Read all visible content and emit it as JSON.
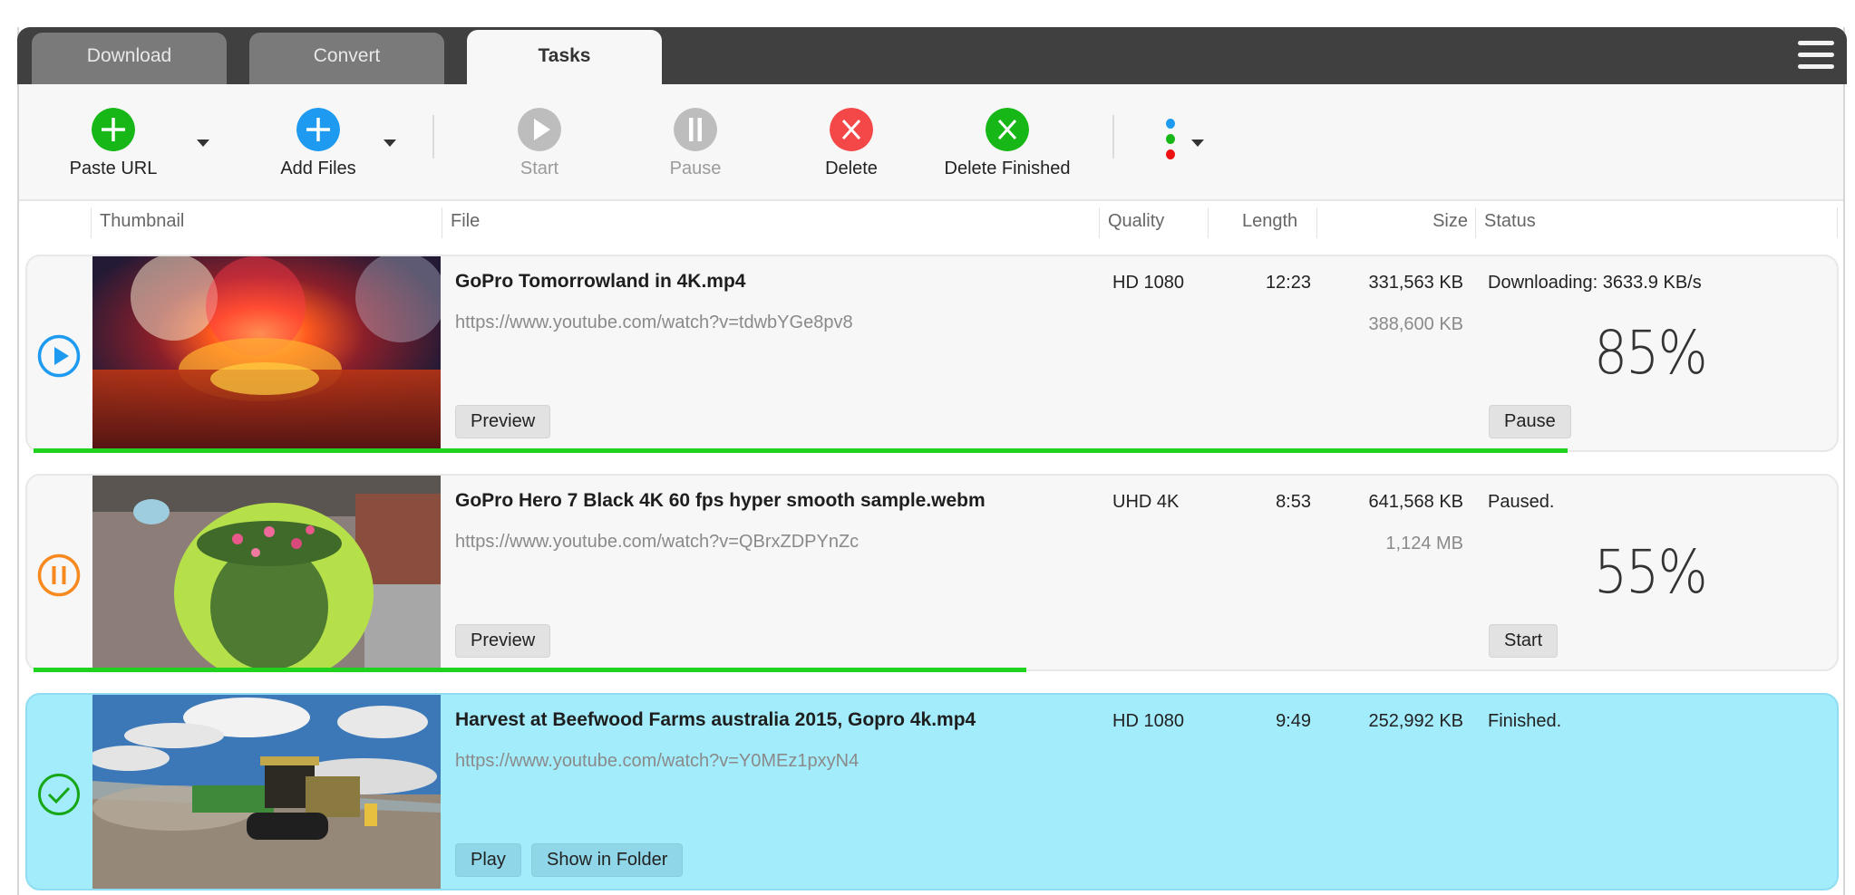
{
  "tabs": [
    {
      "label": "Download",
      "active": false
    },
    {
      "label": "Convert",
      "active": false
    },
    {
      "label": "Tasks",
      "active": true
    }
  ],
  "menu_icon": "hamburger-menu-icon",
  "toolbar": {
    "paste_url": {
      "label": "Paste URL",
      "icon": "plus-circle-icon",
      "color": "#16b716"
    },
    "add_files": {
      "label": "Add Files",
      "icon": "plus-circle-icon",
      "color": "#1e9bf0"
    },
    "start": {
      "label": "Start",
      "icon": "play-circle-icon",
      "enabled": false
    },
    "pause": {
      "label": "Pause",
      "icon": "pause-circle-icon",
      "enabled": false
    },
    "delete": {
      "label": "Delete",
      "icon": "x-circle-icon",
      "color": "#f44848"
    },
    "delete_finished": {
      "label": "Delete Finished",
      "icon": "x-circle-icon",
      "color": "#16b716"
    },
    "more": {
      "icon": "colored-dots-icon",
      "dot_colors": [
        "#1e9bf0",
        "#16b716",
        "#ee1111"
      ]
    }
  },
  "columns": {
    "thumbnail": "Thumbnail",
    "file": "File",
    "quality": "Quality",
    "length": "Length",
    "size": "Size",
    "status": "Status"
  },
  "tasks": [
    {
      "state": "downloading",
      "state_icon": "play-circle-icon",
      "thumbnail": "fireworks over festival crowd",
      "file_name": "GoPro  Tomorrowland in 4K.mp4",
      "url": "https://www.youtube.com/watch?v=tdwbYGe8pv8",
      "quality": "HD 1080",
      "length": "12:23",
      "size": "331,563 KB",
      "total_size": "388,600 KB",
      "status": "Downloading: 3633.9 KB/s",
      "percent_label": "85%",
      "progress": 0.85,
      "buttons": [
        "Preview"
      ],
      "action_button": "Pause"
    },
    {
      "state": "paused",
      "state_icon": "pause-circle-icon",
      "thumbnail": "flower planter on brick sidewalk",
      "file_name": "GoPro Hero 7 Black 4K 60 fps hyper smooth sample.webm",
      "url": "https://www.youtube.com/watch?v=QBrxZDPYnZc",
      "quality": "UHD 4K",
      "length": "8:53",
      "size": "641,568 KB",
      "total_size": "1,124 MB",
      "status": "Paused.",
      "percent_label": "55%",
      "progress": 0.55,
      "buttons": [
        "Preview"
      ],
      "action_button": "Start"
    },
    {
      "state": "finished",
      "state_icon": "check-circle-icon",
      "thumbnail": "tractor in dusty field",
      "file_name": "Harvest at Beefwood Farms australia 2015, Gopro 4k.mp4",
      "url": "https://www.youtube.com/watch?v=Y0MEz1pxyN4",
      "quality": "HD 1080",
      "length": "9:49",
      "size": "252,992 KB",
      "status": "Finished.",
      "buttons": [
        "Play",
        "Show in Folder"
      ]
    }
  ]
}
